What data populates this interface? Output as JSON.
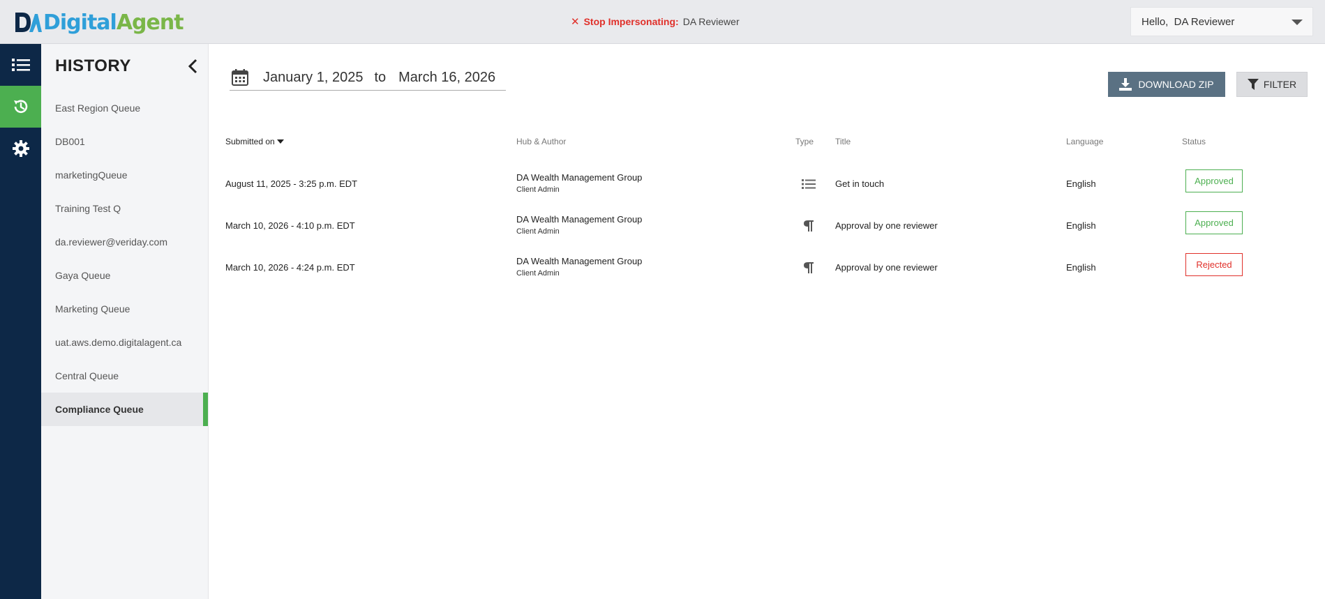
{
  "header": {
    "logo": {
      "part1": "Digital",
      "part2": "Agent"
    },
    "impersonation": {
      "stop_label": "Stop Impersonating:",
      "user": "DA Reviewer"
    },
    "user_menu": {
      "greeting": "Hello,  DA Reviewer"
    }
  },
  "rail": {
    "items": [
      {
        "icon": "list-icon",
        "active": false
      },
      {
        "icon": "history-icon",
        "active": true
      },
      {
        "icon": "gear-icon",
        "active": false
      }
    ]
  },
  "sidebar": {
    "title": "HISTORY",
    "queues": [
      "East Region Queue",
      "DB001",
      "marketingQueue",
      "Training Test Q",
      "da.reviewer@veriday.com",
      "Gaya Queue",
      "Marketing Queue",
      "uat.aws.demo.digitalagent.ca",
      "Central Queue",
      "Compliance Queue"
    ],
    "selected_index": 9
  },
  "date_range": {
    "from": "January 1, 2025",
    "separator": "to",
    "to": "March 16, 2026"
  },
  "toolbar": {
    "download_label": "DOWNLOAD ZIP",
    "filter_label": "FILTER"
  },
  "table": {
    "headers": {
      "submitted": "Submitted on",
      "hub": "Hub & Author",
      "type": "Type",
      "title": "Title",
      "language": "Language",
      "status": "Status"
    },
    "rows": [
      {
        "submitted": "August 11, 2025 - 3:25 p.m. EDT",
        "hub": "DA Wealth Management Group",
        "author": "Client Admin",
        "type_icon": "list-icon",
        "title": "Get in touch",
        "language": "English",
        "status": "Approved"
      },
      {
        "submitted": "March 10, 2026 - 4:10 p.m. EDT",
        "hub": "DA Wealth Management Group",
        "author": "Client Admin",
        "type_icon": "paragraph-icon",
        "title": "Approval by one reviewer",
        "language": "English",
        "status": "Approved"
      },
      {
        "submitted": "March 10, 2026 - 4:24 p.m. EDT",
        "hub": "DA Wealth Management Group",
        "author": "Client Admin",
        "type_icon": "paragraph-icon",
        "title": "Approval by one reviewer",
        "language": "English",
        "status": "Rejected"
      }
    ]
  },
  "colors": {
    "brand_blue": "#2f9fd9",
    "brand_green": "#7ab648",
    "rail_bg": "#0d2847",
    "active_green": "#4caf50",
    "rejected_red": "#e0302a"
  }
}
